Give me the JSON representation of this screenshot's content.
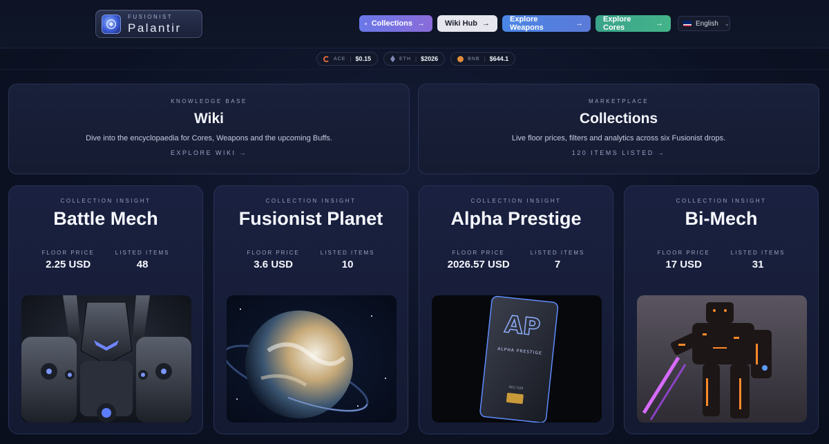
{
  "brand": {
    "small": "FUSIONIST",
    "name": "Palantir"
  },
  "nav": {
    "collections": "Collections",
    "wiki_hub": "Wiki Hub",
    "explore_weapons": "Explore Weapons",
    "explore_cores": "Explore Cores",
    "language": "English"
  },
  "ticker": [
    {
      "symbol": "ACE",
      "price": "$0.15"
    },
    {
      "symbol": "ETH",
      "price": "$2026"
    },
    {
      "symbol": "BNB",
      "price": "$644.1"
    }
  ],
  "wiki_card": {
    "eyebrow": "KNOWLEDGE BASE",
    "title": "Wiki",
    "description": "Dive into the encyclopaedia for Cores, Weapons and the upcoming Buffs.",
    "link": "EXPLORE WIKI →"
  },
  "collections_card": {
    "eyebrow": "MARKETPLACE",
    "title": "Collections",
    "description": "Live floor prices, filters and analytics across six Fusionist drops.",
    "link": "120 ITEMS LISTED →"
  },
  "insight_label": "COLLECTION INSIGHT",
  "floor_label": "FLOOR PRICE",
  "listed_label": "LISTED ITEMS",
  "collections": [
    {
      "name": "Battle Mech",
      "floor": "2.25 USD",
      "listed": "48"
    },
    {
      "name": "Fusionist Planet",
      "floor": "3.6 USD",
      "listed": "10"
    },
    {
      "name": "Alpha Prestige",
      "floor": "2026.57 USD",
      "listed": "7"
    },
    {
      "name": "Bi-Mech",
      "floor": "17 USD",
      "listed": "31"
    }
  ],
  "alpha_card_text": {
    "logo": "AP",
    "label": "ALPHA PRESTIGE",
    "serial": "001/500"
  },
  "colors": {
    "collections_btn": "#6a78e8",
    "weapons_btn": "#4a86e6",
    "cores_btn": "#3aa38a",
    "background": "#0b1020"
  }
}
